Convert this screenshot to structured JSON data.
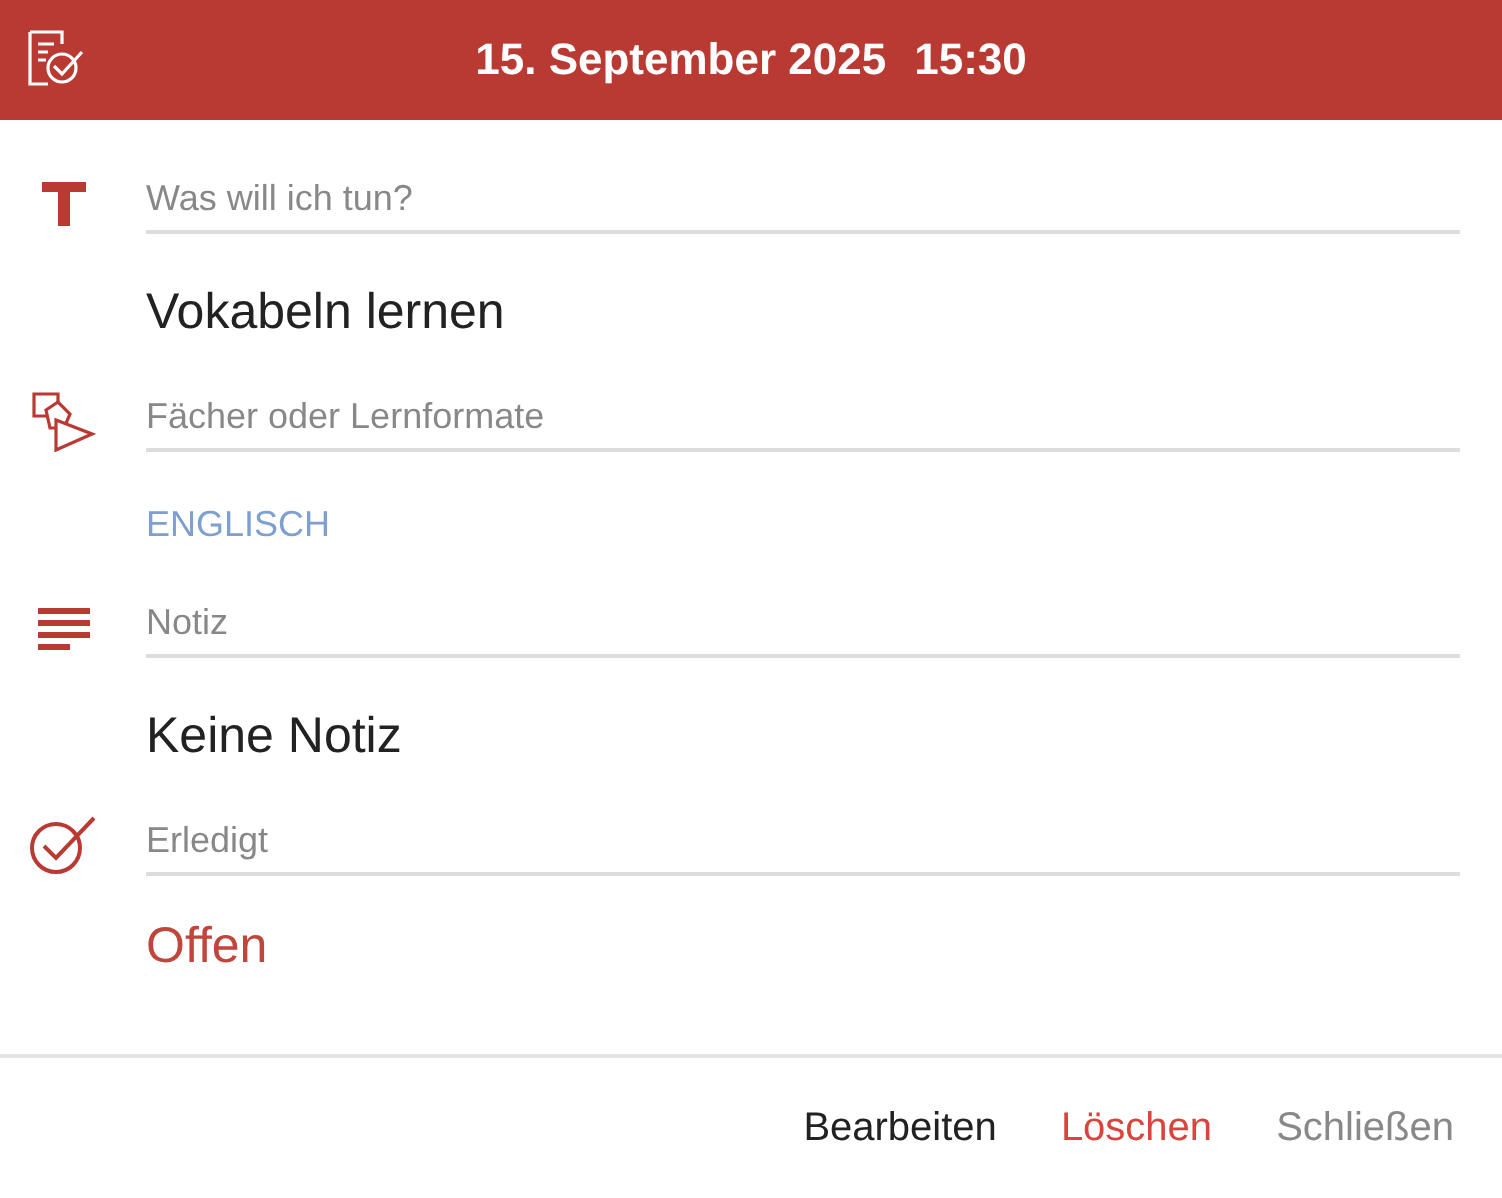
{
  "header": {
    "date": "15. September 2025",
    "time": "15:30"
  },
  "fields": [
    {
      "label": "Was will ich tun?",
      "kind": "text",
      "value": "Vokabeln lernen"
    },
    {
      "label": "Fächer oder Lernformate",
      "kind": "tag",
      "value": "ENGLISCH"
    },
    {
      "label": "Notiz",
      "kind": "text",
      "value": "Keine Notiz"
    },
    {
      "label": "Erledigt",
      "kind": "status",
      "value": "Offen"
    }
  ],
  "buttons": [
    {
      "label": "Bearbeiten",
      "kind": "primary"
    },
    {
      "label": "Löschen",
      "kind": "danger"
    },
    {
      "label": "Schließen",
      "kind": "muted"
    }
  ]
}
